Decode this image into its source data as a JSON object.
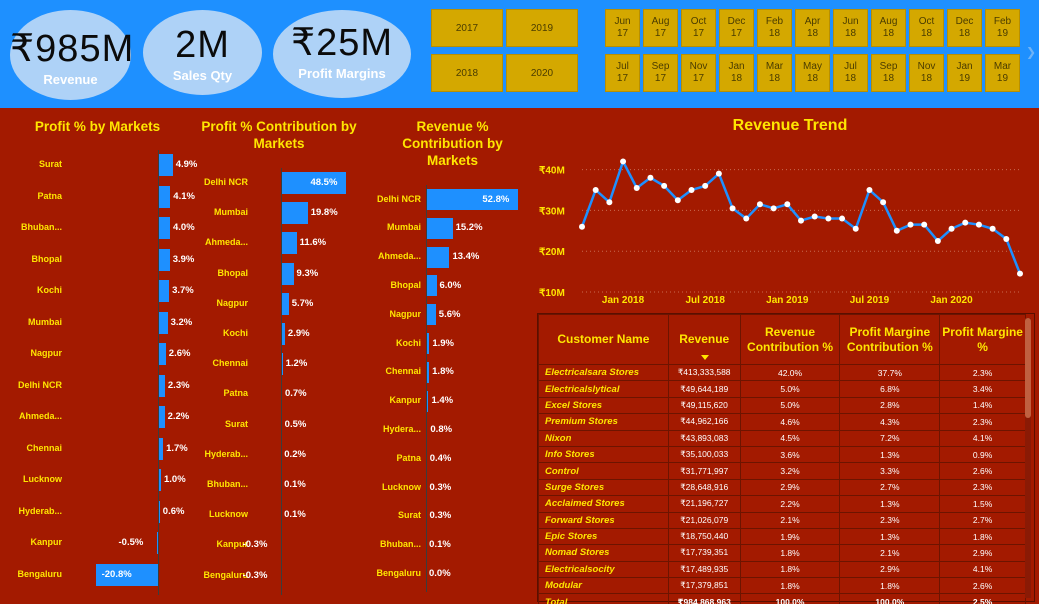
{
  "kpis": [
    {
      "value": "₹985M",
      "label": "Revenue"
    },
    {
      "value": "2M",
      "label": "Sales Qty"
    },
    {
      "value": "₹25M",
      "label": "Profit Margins"
    }
  ],
  "year_slicer": [
    "2017",
    "2019",
    "2018",
    "2020"
  ],
  "month_slicer": [
    "Jun\n17",
    "Aug\n17",
    "Oct\n17",
    "Dec\n17",
    "Feb\n18",
    "Apr\n18",
    "Jun\n18",
    "Aug\n18",
    "Oct\n18",
    "Dec\n18",
    "Feb\n19",
    "Jul\n17",
    "Sep\n17",
    "Nov\n17",
    "Jan\n18",
    "Mar\n18",
    "May\n18",
    "Jul\n18",
    "Sep\n18",
    "Nov\n18",
    "Jan\n19",
    "Mar\n19"
  ],
  "colors": {
    "background": "#a31a00",
    "header": "#1e90ff",
    "accent": "#ffe600",
    "bar": "#1e90ff",
    "slicer": "#d4a800"
  },
  "chart_data": [
    {
      "type": "bar",
      "title": "Profit % by Markets",
      "categories": [
        "Surat",
        "Patna",
        "Bhuban...",
        "Bhopal",
        "Kochi",
        "Mumbai",
        "Nagpur",
        "Delhi NCR",
        "Ahmeda...",
        "Chennai",
        "Lucknow",
        "Hyderab...",
        "Kanpur",
        "Bengaluru"
      ],
      "values": [
        4.9,
        4.1,
        4.0,
        3.9,
        3.7,
        3.2,
        2.6,
        2.3,
        2.2,
        1.7,
        1.0,
        0.6,
        -0.5,
        -20.8
      ],
      "labels": [
        "4.9%",
        "4.1%",
        "4.0%",
        "3.9%",
        "3.7%",
        "3.2%",
        "2.6%",
        "2.3%",
        "2.2%",
        "1.7%",
        "1.0%",
        "0.6%",
        "-0.5%",
        "-20.8%"
      ]
    },
    {
      "type": "bar",
      "title": "Profit % Contribution by Markets",
      "categories": [
        "Delhi NCR",
        "Mumbai",
        "Ahmeda...",
        "Bhopal",
        "Nagpur",
        "Kochi",
        "Chennai",
        "Patna",
        "Surat",
        "Hyderab...",
        "Bhuban...",
        "Lucknow",
        "Kanpur",
        "Bengaluru"
      ],
      "values": [
        48.5,
        19.8,
        11.6,
        9.3,
        5.7,
        2.9,
        1.2,
        0.7,
        0.5,
        0.2,
        0.1,
        0.1,
        -0.3,
        -0.3
      ],
      "labels": [
        "48.5%",
        "19.8%",
        "11.6%",
        "9.3%",
        "5.7%",
        "2.9%",
        "1.2%",
        "0.7%",
        "0.5%",
        "0.2%",
        "0.1%",
        "0.1%",
        "-0.3%",
        "-0.3%"
      ]
    },
    {
      "type": "bar",
      "title": "Revenue % Contribution by Markets",
      "categories": [
        "Delhi NCR",
        "Mumbai",
        "Ahmeda...",
        "Bhopal",
        "Nagpur",
        "Kochi",
        "Chennai",
        "Kanpur",
        "Hydera...",
        "Patna",
        "Lucknow",
        "Surat",
        "Bhuban...",
        "Bengaluru"
      ],
      "values": [
        52.8,
        15.2,
        13.4,
        6.0,
        5.6,
        1.9,
        1.8,
        1.4,
        0.8,
        0.4,
        0.3,
        0.3,
        0.1,
        0.0
      ],
      "labels": [
        "52.8%",
        "15.2%",
        "13.4%",
        "6.0%",
        "5.6%",
        "1.9%",
        "1.8%",
        "1.4%",
        "0.8%",
        "0.4%",
        "0.3%",
        "0.3%",
        "0.1%",
        "0.0%"
      ]
    },
    {
      "type": "line",
      "title": "Revenue Trend",
      "x": [
        "2017-10",
        "2017-11",
        "2017-12",
        "2018-01",
        "2018-02",
        "2018-03",
        "2018-04",
        "2018-05",
        "2018-06",
        "2018-07",
        "2018-08",
        "2018-09",
        "2018-10",
        "2018-11",
        "2018-12",
        "2019-01",
        "2019-02",
        "2019-03",
        "2019-04",
        "2019-05",
        "2019-06",
        "2019-07",
        "2019-08",
        "2019-09",
        "2019-10",
        "2019-11",
        "2019-12",
        "2020-01",
        "2020-02",
        "2020-03",
        "2020-04",
        "2020-05",
        "2020-06"
      ],
      "values": [
        26.0,
        35.0,
        32.0,
        42.0,
        35.5,
        38.0,
        36.0,
        32.5,
        35.0,
        36.0,
        39.0,
        30.5,
        28.0,
        31.5,
        30.5,
        31.5,
        27.5,
        28.5,
        28.0,
        28.0,
        25.5,
        35.0,
        32.0,
        25.0,
        26.5,
        26.5,
        22.5,
        25.5,
        27.0,
        26.5,
        25.5,
        23.0,
        14.5
      ],
      "yticks": [
        "₹10M",
        "₹20M",
        "₹30M",
        "₹40M"
      ],
      "xticks": [
        "Jan 2018",
        "Jul 2018",
        "Jan 2019",
        "Jul 2019",
        "Jan 2020"
      ],
      "ylim": [
        10,
        45
      ],
      "grid": true
    }
  ],
  "table": {
    "columns": [
      "Customer Name",
      "Revenue",
      "Revenue Contribution %",
      "Profit Margine Contribution %",
      "Profit Margine %"
    ],
    "rows": [
      [
        "Electricalsara Stores",
        "₹413,333,588",
        "42.0%",
        "37.7%",
        "2.3%"
      ],
      [
        "Electricalslytical",
        "₹49,644,189",
        "5.0%",
        "6.8%",
        "3.4%"
      ],
      [
        "Excel Stores",
        "₹49,115,620",
        "5.0%",
        "2.8%",
        "1.4%"
      ],
      [
        "Premium Stores",
        "₹44,962,166",
        "4.6%",
        "4.3%",
        "2.3%"
      ],
      [
        "Nixon",
        "₹43,893,083",
        "4.5%",
        "7.2%",
        "4.1%"
      ],
      [
        "Info Stores",
        "₹35,100,033",
        "3.6%",
        "1.3%",
        "0.9%"
      ],
      [
        "Control",
        "₹31,771,997",
        "3.2%",
        "3.3%",
        "2.6%"
      ],
      [
        "Surge Stores",
        "₹28,648,916",
        "2.9%",
        "2.7%",
        "2.3%"
      ],
      [
        "Acclaimed Stores",
        "₹21,196,727",
        "2.2%",
        "1.3%",
        "1.5%"
      ],
      [
        "Forward Stores",
        "₹21,026,079",
        "2.1%",
        "2.3%",
        "2.7%"
      ],
      [
        "Epic Stores",
        "₹18,750,440",
        "1.9%",
        "1.3%",
        "1.8%"
      ],
      [
        "Nomad Stores",
        "₹17,739,351",
        "1.8%",
        "2.1%",
        "2.9%"
      ],
      [
        "Electricalsocity",
        "₹17,489,935",
        "1.8%",
        "2.9%",
        "4.1%"
      ],
      [
        "Modular",
        "₹17,379,851",
        "1.8%",
        "1.8%",
        "2.6%"
      ]
    ],
    "total": [
      "Total",
      "₹984,868,963",
      "100.0%",
      "100.0%",
      "2.5%"
    ]
  }
}
